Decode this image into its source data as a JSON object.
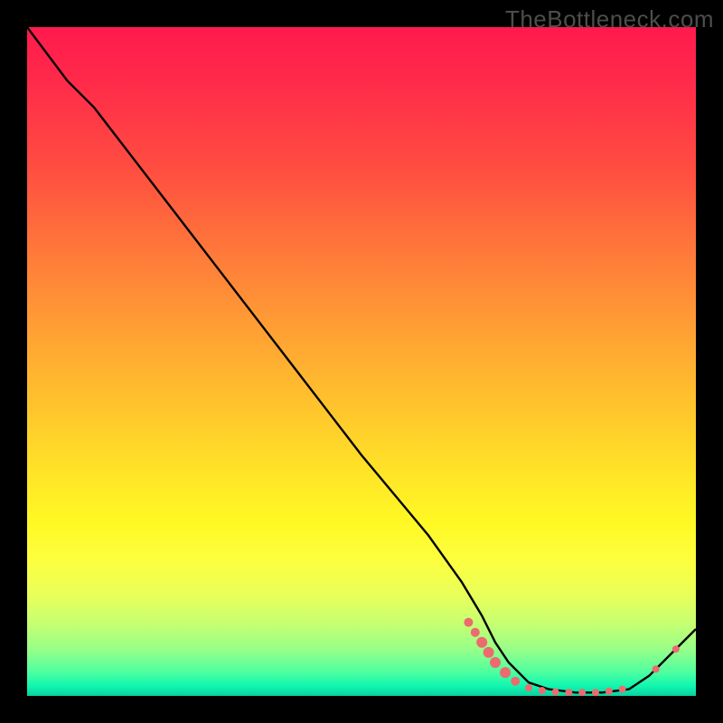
{
  "watermark": "TheBottleneck.com",
  "chart_data": {
    "type": "line",
    "title": "",
    "xlabel": "",
    "ylabel": "",
    "xlim": [
      0,
      100
    ],
    "ylim": [
      0,
      100
    ],
    "series": [
      {
        "name": "main-curve",
        "x": [
          0,
          6,
          10,
          20,
          30,
          40,
          50,
          60,
          65,
          68,
          70,
          72,
          75,
          78,
          82,
          86,
          90,
          93,
          96,
          100
        ],
        "y": [
          100,
          92,
          88,
          75,
          62,
          49,
          36,
          24,
          17,
          12,
          8,
          5,
          2,
          1,
          0.5,
          0.5,
          1,
          3,
          6,
          10
        ]
      }
    ],
    "markers": [
      {
        "x": 66.0,
        "y": 11.0,
        "r": 5
      },
      {
        "x": 67.0,
        "y": 9.5,
        "r": 5
      },
      {
        "x": 68.0,
        "y": 8.0,
        "r": 6
      },
      {
        "x": 69.0,
        "y": 6.5,
        "r": 6
      },
      {
        "x": 70.0,
        "y": 5.0,
        "r": 6
      },
      {
        "x": 71.5,
        "y": 3.5,
        "r": 6
      },
      {
        "x": 73.0,
        "y": 2.2,
        "r": 5
      },
      {
        "x": 75.0,
        "y": 1.2,
        "r": 4
      },
      {
        "x": 77.0,
        "y": 0.8,
        "r": 4
      },
      {
        "x": 79.0,
        "y": 0.6,
        "r": 4
      },
      {
        "x": 81.0,
        "y": 0.5,
        "r": 4
      },
      {
        "x": 83.0,
        "y": 0.5,
        "r": 4
      },
      {
        "x": 85.0,
        "y": 0.5,
        "r": 4
      },
      {
        "x": 87.0,
        "y": 0.7,
        "r": 4
      },
      {
        "x": 89.0,
        "y": 1.0,
        "r": 4
      },
      {
        "x": 94.0,
        "y": 4.0,
        "r": 4
      },
      {
        "x": 97.0,
        "y": 7.0,
        "r": 4
      }
    ],
    "marker_color": "#ed6a6f",
    "curve_color": "#000000",
    "gradient_stops": [
      {
        "pos": 0,
        "color": "#ff1a4d"
      },
      {
        "pos": 0.5,
        "color": "#ffc030"
      },
      {
        "pos": 0.78,
        "color": "#fff824"
      },
      {
        "pos": 0.95,
        "color": "#7affa0"
      },
      {
        "pos": 1.0,
        "color": "#0cd0a0"
      }
    ]
  }
}
